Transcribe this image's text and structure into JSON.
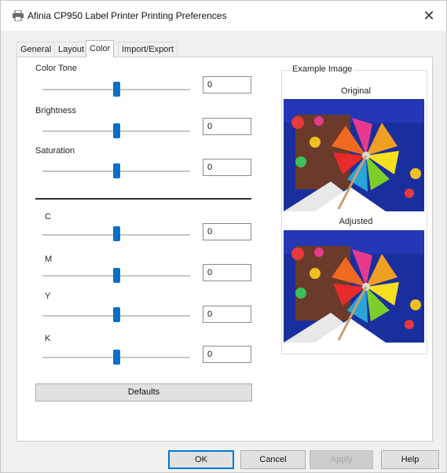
{
  "window": {
    "title": "Afinia CP950 Label Printer Printing Preferences",
    "close_glyph": "✕"
  },
  "tabs": [
    {
      "label": "General",
      "active": false
    },
    {
      "label": "Layout",
      "active": false
    },
    {
      "label": "Color",
      "active": true
    },
    {
      "label": "Import/Export",
      "active": false
    }
  ],
  "sliders": [
    {
      "label": "Color Tone",
      "value": "0",
      "level": 0.5
    },
    {
      "label": "Brightness",
      "value": "0",
      "level": 0.5
    },
    {
      "label": "Saturation",
      "value": "0",
      "level": 0.5
    },
    {
      "label": "C",
      "value": "0",
      "level": 0.5
    },
    {
      "label": "M",
      "value": "0",
      "level": 0.5
    },
    {
      "label": "Y",
      "value": "0",
      "level": 0.5
    },
    {
      "label": "K",
      "value": "0",
      "level": 0.5
    }
  ],
  "defaults_label": "Defaults",
  "example": {
    "title": "Example Image",
    "original_caption": "Original",
    "adjusted_caption": "Adjusted"
  },
  "buttons": {
    "ok": "OK",
    "cancel": "Cancel",
    "apply": "Apply",
    "help": "Help"
  },
  "colors": {
    "accent": "#0a6fc9",
    "focus_border": "#0078d7"
  }
}
